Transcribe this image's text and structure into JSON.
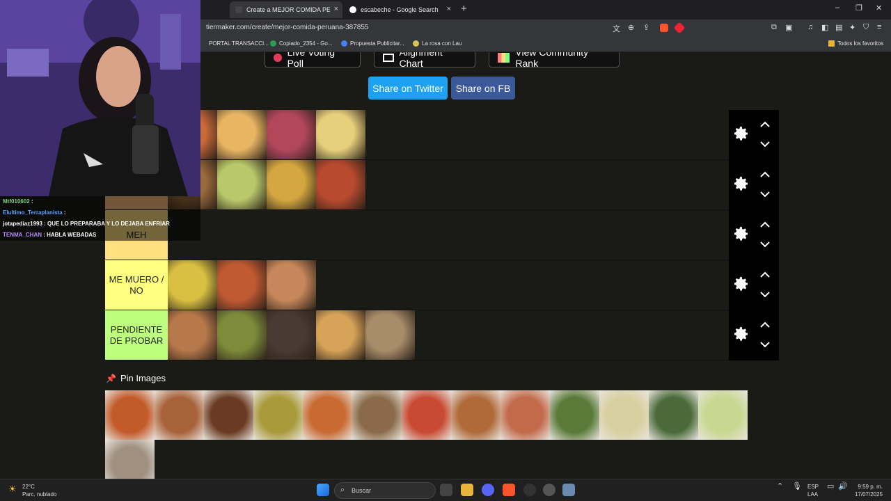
{
  "browser": {
    "tabs": [
      {
        "label": "Create a MEJOR COMIDA PERUANA",
        "close": "×",
        "active": true
      },
      {
        "label": "escabeche - Google Search",
        "close": "×",
        "active": false
      }
    ],
    "new_tab": "+",
    "window_controls": {
      "minimize": "–",
      "restore": "❐",
      "close": "✕"
    },
    "url": "tiermaker.com/create/mejor-comida-peruana-387855",
    "bookmarks": [
      "PORTAL TRANSACCI...",
      "Copiado_2354 - Go...",
      "Propuesta Publicitar...",
      "La rosa con Lau"
    ],
    "all_bookmarks": "Todos los favoritos"
  },
  "page": {
    "top_buttons": [
      "Live Voting Poll",
      "Alignment Chart",
      "View Community Rank"
    ],
    "share_twitter": "Share on Twitter",
    "share_fb": "Share on FB",
    "tiers": [
      {
        "label": "",
        "color": "#ff7f7f",
        "images": [
          "#c96a3a",
          "#e8b563",
          "#b2475c",
          "#e7d07b"
        ]
      },
      {
        "label": "",
        "color": "#ffbf7f",
        "images": [
          "#9b6a3c",
          "#b9c86a",
          "#d4a63f",
          "#b84a2e"
        ]
      },
      {
        "label": "MEH",
        "color": "#ffdf7f",
        "images": []
      },
      {
        "label": "ME MUERO / NO",
        "color": "#ffff7f",
        "images": [
          "#d9c042",
          "#c05a32",
          "#c7875a"
        ]
      },
      {
        "label": "PENDIENTE DE PROBAR",
        "color": "#bfff7f",
        "images": [
          "#b7794a",
          "#7d8b3a",
          "#4a3a34",
          "#d7a358",
          "#a88d6a"
        ]
      }
    ],
    "pin_title": "Pin Images",
    "pin_images": [
      "#c25a2a",
      "#a8623a",
      "#6a3a22",
      "#a89a3a",
      "#c86a32",
      "#8a6a4a",
      "#c84a32",
      "#b06a3a",
      "#c26a4a",
      "#5a7a3a",
      "#d8d0a0",
      "#4a6a3a",
      "#c8d890",
      "#a09080"
    ]
  },
  "stream": {
    "chat": [
      {
        "user": "Mtf010602",
        "text": "",
        "color": "#7cd17c"
      },
      {
        "user": "Elultimo_Terraplanista",
        "text": "",
        "color": "#5aa0ff"
      },
      {
        "user": "jotapediaz1993",
        "text": "QUE LO PREPARABA Y LO DEJABA ENFRIAR",
        "color": "#ffffff"
      },
      {
        "user": "TENMA_CHAN",
        "text": "HABLA WEBADAS",
        "color": "#b58cff"
      }
    ]
  },
  "taskbar": {
    "weather_temp": "22°C",
    "weather_desc": "Parc. nublado",
    "search_placeholder": "Buscar",
    "lang": "ESP",
    "lang2": "LAA",
    "time": "9:59 p. m.",
    "date": "17/07/2025"
  }
}
